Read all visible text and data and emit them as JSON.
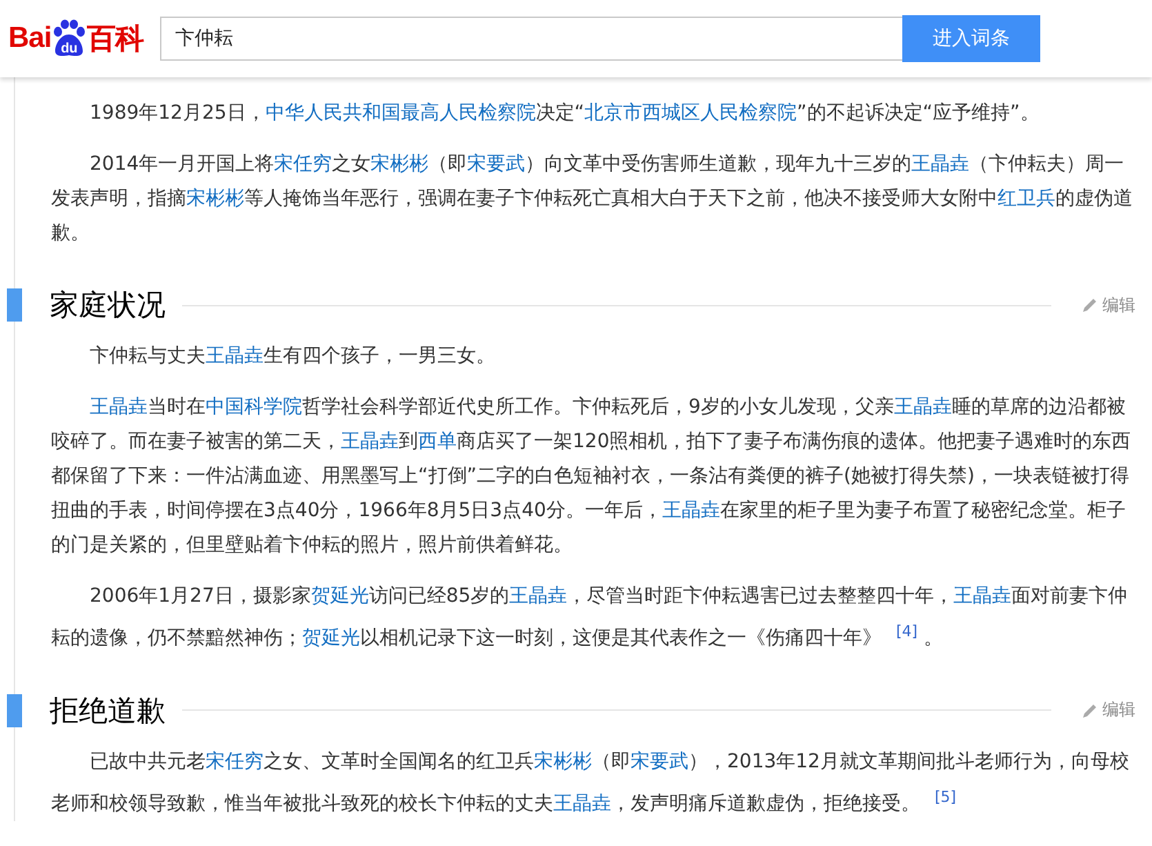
{
  "header": {
    "logo": {
      "left": "Bai",
      "paw": "du",
      "right": "百科"
    },
    "search": {
      "value": "卞仲耘"
    },
    "button": "进入词条"
  },
  "intro_paragraphs": [
    {
      "parts": [
        {
          "kind": "text",
          "text": "1989年12月25日，"
        },
        {
          "kind": "link",
          "text": "中华人民共和国最高人民检察院"
        },
        {
          "kind": "text",
          "text": "决定“"
        },
        {
          "kind": "link",
          "text": "北京市西城区人民检察院"
        },
        {
          "kind": "text",
          "text": "”的不起诉决定“应予维持”。"
        }
      ]
    },
    {
      "parts": [
        {
          "kind": "text",
          "text": "2014年一月开国上将"
        },
        {
          "kind": "link",
          "text": "宋任穷"
        },
        {
          "kind": "text",
          "text": "之女"
        },
        {
          "kind": "link",
          "text": "宋彬彬"
        },
        {
          "kind": "text",
          "text": "（即"
        },
        {
          "kind": "link",
          "text": "宋要武"
        },
        {
          "kind": "text",
          "text": "）向文革中受伤害师生道歉，现年九十三岁的"
        },
        {
          "kind": "link",
          "text": "王晶垚"
        },
        {
          "kind": "text",
          "text": "（卞仲耘夫）周一发表声明，指摘"
        },
        {
          "kind": "link",
          "text": "宋彬彬"
        },
        {
          "kind": "text",
          "text": "等人掩饰当年恶行，强调在妻子卞仲耘死亡真相大白于天下之前，他决不接受师大女附中"
        },
        {
          "kind": "link",
          "text": "红卫兵"
        },
        {
          "kind": "text",
          "text": "的虚伪道歉。"
        }
      ]
    }
  ],
  "sections": [
    {
      "title": "家庭状况",
      "edit": "编辑",
      "paragraphs": [
        {
          "parts": [
            {
              "kind": "text",
              "text": "卞仲耘与丈夫"
            },
            {
              "kind": "link",
              "text": "王晶垚"
            },
            {
              "kind": "text",
              "text": "生有四个孩子，一男三女。"
            }
          ]
        },
        {
          "parts": [
            {
              "kind": "link",
              "text": "王晶垚"
            },
            {
              "kind": "text",
              "text": "当时在"
            },
            {
              "kind": "link",
              "text": "中国科学院"
            },
            {
              "kind": "text",
              "text": "哲学社会科学部近代史所工作。卞仲耘死后，9岁的小女儿发现，父亲"
            },
            {
              "kind": "link",
              "text": "王晶垚"
            },
            {
              "kind": "text",
              "text": "睡的草席的边沿都被咬碎了。而在妻子被害的第二天，"
            },
            {
              "kind": "link",
              "text": "王晶垚"
            },
            {
              "kind": "text",
              "text": "到"
            },
            {
              "kind": "link",
              "text": "西单"
            },
            {
              "kind": "text",
              "text": "商店买了一架120照相机，拍下了妻子布满伤痕的遗体。他把妻子遇难时的东西都保留了下来：一件沾满血迹、用黑墨写上“打倒”二字的白色短袖衬衣，一条沾有粪便的裤子(她被打得失禁)，一块表链被打得扭曲的手表，时间停摆在3点40分，1966年8月5日3点40分。一年后，"
            },
            {
              "kind": "link",
              "text": "王晶垚"
            },
            {
              "kind": "text",
              "text": "在家里的柜子里为妻子布置了秘密纪念堂。柜子的门是关紧的，但里壁贴着卞仲耘的照片，照片前供着鲜花。"
            }
          ]
        },
        {
          "parts": [
            {
              "kind": "text",
              "text": "2006年1月27日，摄影家"
            },
            {
              "kind": "link",
              "text": "贺延光"
            },
            {
              "kind": "text",
              "text": "访问已经85岁的"
            },
            {
              "kind": "link",
              "text": "王晶垚"
            },
            {
              "kind": "text",
              "text": "，尽管当时距卞仲耘遇害已过去整整四十年，"
            },
            {
              "kind": "link",
              "text": "王晶垚"
            },
            {
              "kind": "text",
              "text": "面对前妻卞仲耘的遗像，仍不禁黯然神伤；"
            },
            {
              "kind": "link",
              "text": "贺延光"
            },
            {
              "kind": "text",
              "text": "以相机记录下这一时刻，这便是其代表作之一《伤痛四十年》 "
            },
            {
              "kind": "ref",
              "text": "[4]"
            },
            {
              "kind": "text",
              "text": " 。"
            }
          ]
        }
      ]
    },
    {
      "title": "拒绝道歉",
      "edit": "编辑",
      "paragraphs": [
        {
          "parts": [
            {
              "kind": "text",
              "text": "已故中共元老"
            },
            {
              "kind": "link",
              "text": "宋任穷"
            },
            {
              "kind": "text",
              "text": "之女、文革时全国闻名的红卫兵"
            },
            {
              "kind": "link",
              "text": "宋彬彬"
            },
            {
              "kind": "text",
              "text": "（即"
            },
            {
              "kind": "link",
              "text": "宋要武"
            },
            {
              "kind": "text",
              "text": "），2013年12月就文革期间批斗老师行为，向母校老师和校领导致歉，惟当年被批斗致死的校长卞仲耘的丈夫"
            },
            {
              "kind": "link",
              "text": "王晶垚"
            },
            {
              "kind": "text",
              "text": "，发声明痛斥道歉虚伪，拒绝接受。 "
            },
            {
              "kind": "ref",
              "text": "[5]"
            }
          ]
        }
      ]
    }
  ]
}
